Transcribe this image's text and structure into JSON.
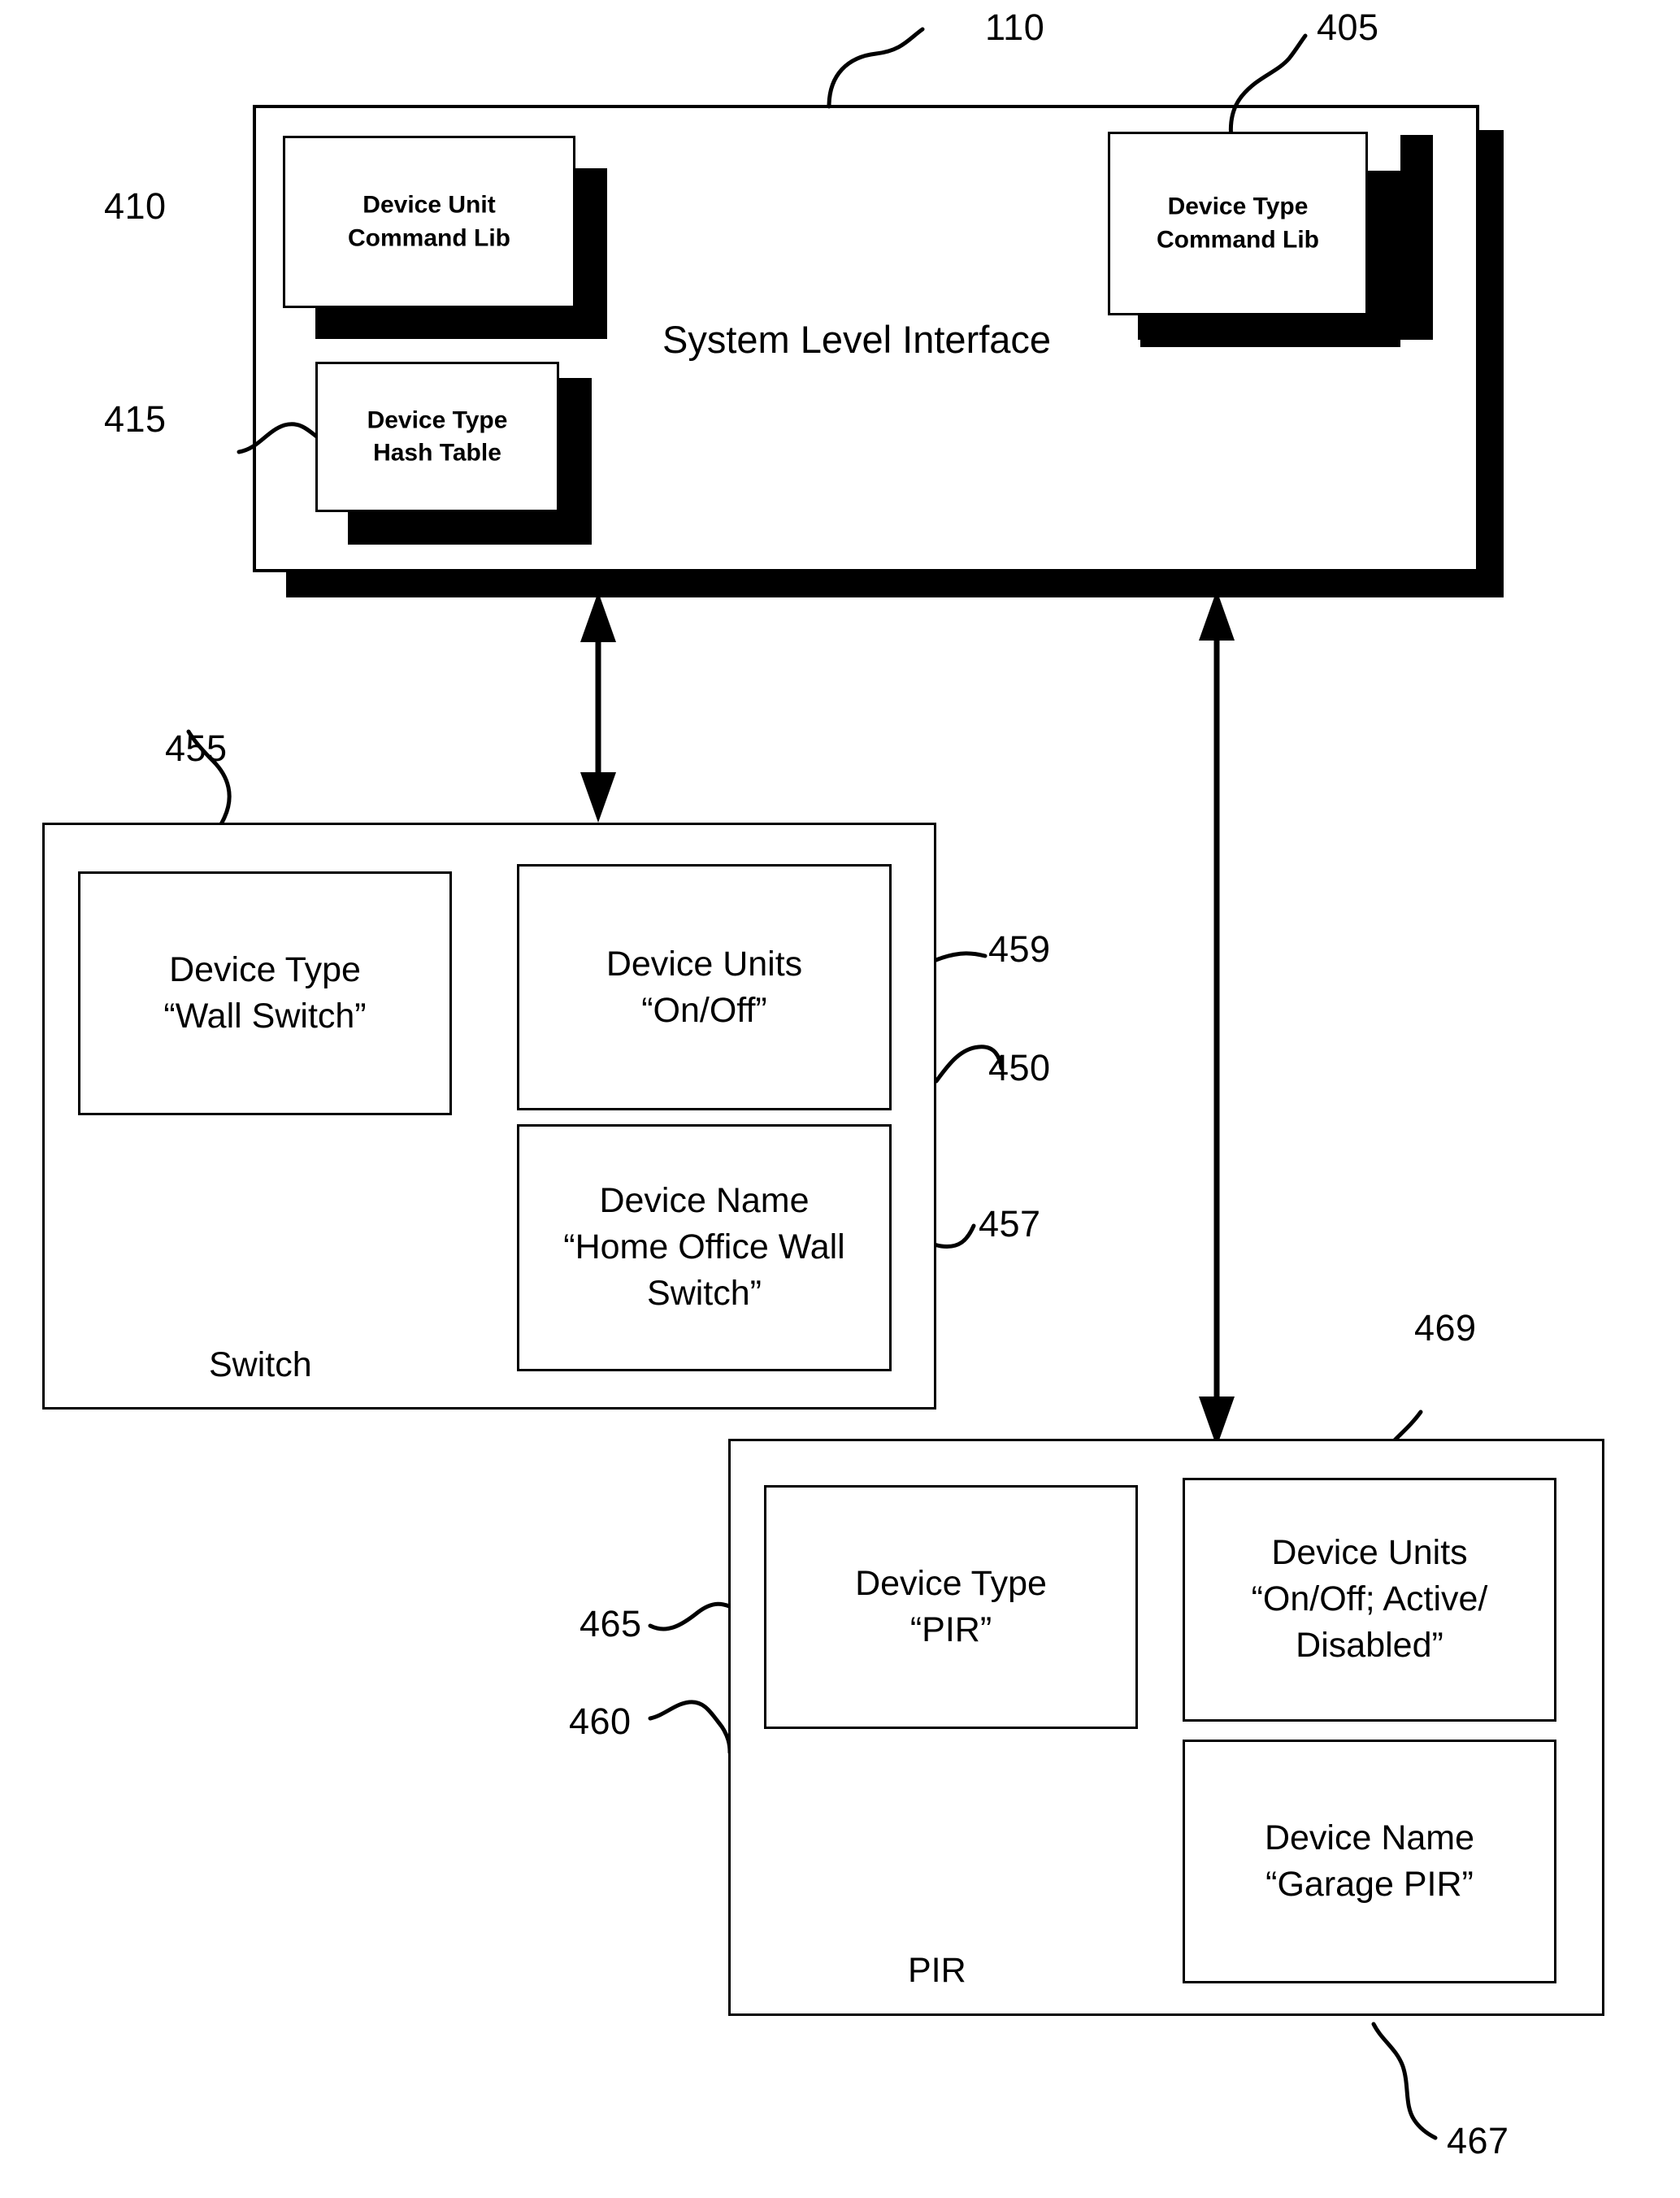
{
  "figure": {
    "system_level_interface": {
      "title": "System Level Interface",
      "ref": "110",
      "components": [
        {
          "ref": "410",
          "label": "Device Unit\nCommand Lib"
        },
        {
          "ref": "415",
          "label": "Device Type\nHash Table"
        },
        {
          "ref": "405",
          "label": "Device Type\nCommand Lib"
        }
      ]
    },
    "switch_object": {
      "name": "Switch",
      "ref": "450",
      "fields": [
        {
          "ref": "455",
          "label": "Device Type\n“Wall Switch”"
        },
        {
          "ref": "459",
          "label": "Device Units\n“On/Off”"
        },
        {
          "ref": "457",
          "label": "Device Name\n“Home Office Wall\nSwitch”"
        }
      ]
    },
    "pir_object": {
      "name": "PIR",
      "ref": "460",
      "fields": [
        {
          "ref": "465",
          "label": "Device Type\n“PIR”"
        },
        {
          "ref": "469",
          "label": "Device Units\n“On/Off; Active/\nDisabled”"
        },
        {
          "ref": "467",
          "label": "Device Name\n“Garage PIR”"
        }
      ]
    },
    "connectors": [
      {
        "name": "sli-to-switch",
        "kind": "double-arrow"
      },
      {
        "name": "sli-to-pir",
        "kind": "double-arrow"
      }
    ]
  }
}
